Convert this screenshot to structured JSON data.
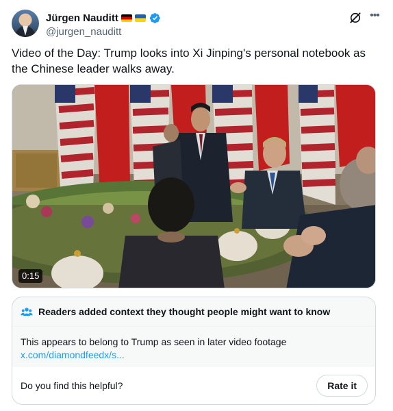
{
  "author": {
    "display_name": "Jürgen Nauditt",
    "handle": "@jurgen_nauditt",
    "flags": [
      "germany-flag",
      "ukraine-flag"
    ],
    "verified": true,
    "verified_color": "#1d9bf0"
  },
  "tweet": {
    "text": "Video of the Day: Trump looks into Xi Jinping's personal notebook as the Chinese leader walks away."
  },
  "media": {
    "type": "video",
    "duration": "0:15"
  },
  "community_note": {
    "title": "Readers added context they thought people might want to know",
    "text": "This appears to belong to Trump as seen in later video footage",
    "link_text": "x.com/diamondfeedx/s...",
    "helpful_question": "Do you find this helpful?",
    "rate_label": "Rate it",
    "icon": "people-icon",
    "icon_color": "#1d9bf0"
  },
  "icons": {
    "grok": "grok-icon",
    "more": "more-icon"
  }
}
